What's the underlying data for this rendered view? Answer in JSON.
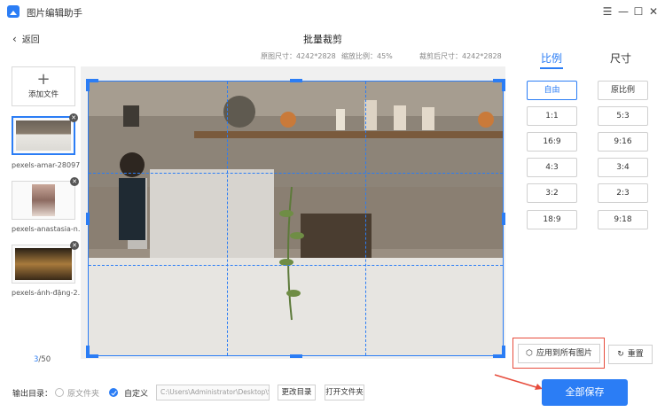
{
  "app": {
    "title": "图片编辑助手"
  },
  "header": {
    "back_label": "返回",
    "page_title": "批量裁剪"
  },
  "info": {
    "original_size": "原图尺寸：4242*2828",
    "zoom": "缩放比例：45%",
    "cropped_size": "裁剪后尺寸：4242*2828"
  },
  "sidebar": {
    "add_label": "添加文件",
    "files": [
      {
        "name": "pexels-amar-28097..."
      },
      {
        "name": "pexels-anastasia-n..."
      },
      {
        "name": "pexels-ánh-đặng-2..."
      }
    ],
    "page_current": "3",
    "page_total": "/50"
  },
  "tabs": {
    "ratio": "比例",
    "size": "尺寸"
  },
  "ratios": [
    "自由",
    "原比例",
    "1:1",
    "5:3",
    "16:9",
    "9:16",
    "4:3",
    "3:4",
    "3:2",
    "2:3",
    "18:9",
    "9:18"
  ],
  "actions": {
    "apply_all": "应用到所有图片",
    "reset": "重置"
  },
  "bottom": {
    "output_label": "输出目录：",
    "option_original": "原文件夹",
    "option_custom": "自定义",
    "path": "C:\\Users\\Administrator\\Desktop\\S",
    "change_dir": "更改目录",
    "open_folder": "打开文件夹",
    "save_all": "全部保存"
  }
}
